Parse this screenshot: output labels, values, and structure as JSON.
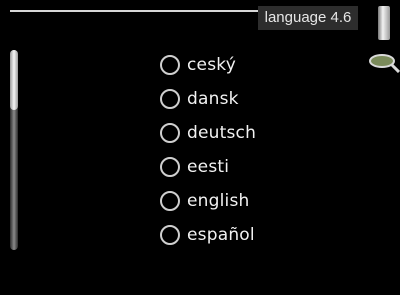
{
  "header": {
    "title": "language 4.6"
  },
  "icons": {
    "lens": "magnifier-icon",
    "tab": "side-tab"
  },
  "colors": {
    "background": "#000000",
    "header_box": "#2d2d2d",
    "text": "#f2f2f2"
  },
  "scroll": {
    "position": 0.0
  },
  "languages": [
    {
      "label": "ceský"
    },
    {
      "label": "dansk"
    },
    {
      "label": "deutsch"
    },
    {
      "label": "eesti"
    },
    {
      "label": "english"
    },
    {
      "label": "español"
    }
  ]
}
